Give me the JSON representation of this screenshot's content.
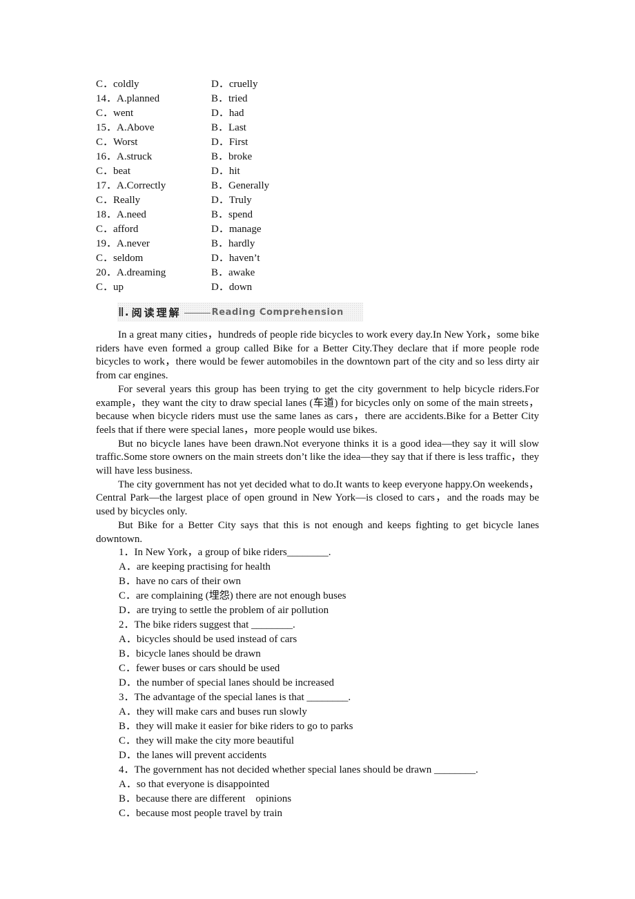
{
  "cloze_options": [
    {
      "left": "C．coldly",
      "right": "D．cruelly"
    },
    {
      "left": "14．A.planned",
      "right": "B．tried"
    },
    {
      "left": "C．went",
      "right": "D．had"
    },
    {
      "left": "15．A.Above",
      "right": "B．Last"
    },
    {
      "left": "C．Worst",
      "right": "D．First"
    },
    {
      "left": "16．A.struck",
      "right": "B．broke"
    },
    {
      "left": "C．beat",
      "right": "D．hit"
    },
    {
      "left": "17．A.Correctly",
      "right": "B．Generally"
    },
    {
      "left": "C．Really",
      "right": "D．Truly"
    },
    {
      "left": "18．A.need",
      "right": "B．spend"
    },
    {
      "left": "C．afford",
      "right": "D．manage"
    },
    {
      "left": "19．A.never",
      "right": "B．hardly"
    },
    {
      "left": "C．seldom",
      "right": "D．haven’t"
    },
    {
      "left": "20．A.dreaming",
      "right": "B．awake"
    },
    {
      "left": "C．up",
      "right": "D．down"
    }
  ],
  "section": {
    "roman": "Ⅱ",
    "dot": ".",
    "title_cn": "阅读理解",
    "title_en": "Reading Comprehension"
  },
  "passage": [
    "In a great many cities，hundreds of people ride bicycles to work every day.In New York，some bike riders have even formed a group called Bike for a Better City.They declare that if more people rode bicycles to work，there would be fewer automobiles in the downtown part of the city and so less dirty air from car engines.",
    "For several years this group has been trying to get the city government to help bicycle riders.For example，they want the city to draw special lanes (车道) for bicycles only on some of the main streets，because when bicycle riders must use the same lanes as cars，there are accidents.Bike for a Better City feels that if there were special lanes，more people would use bikes.",
    "But no bicycle lanes have been drawn.Not everyone thinks it is a good idea—they say it will slow traffic.Some store owners on the main streets don’t like the idea—they say that if there is less traffic，they will have less business.",
    "The city government has not yet decided what to do.It wants to keep everyone happy.On weekends，Central Park—the largest place of open ground in New York—is closed to cars，and the roads may be used by bicycles only.",
    "But Bike for a Better City says that this is not enough and keeps fighting to get bicycle lanes downtown."
  ],
  "questions": [
    {
      "stem": "1．In New York，a group of bike riders________.",
      "options": [
        "A．are keeping practising for health",
        "B．have no cars of their own",
        "C．are complaining (埋怨) there are not enough buses",
        "D．are trying to settle the problem of air pollution"
      ]
    },
    {
      "stem": "2．The bike riders suggest that ________.",
      "options": [
        "A．bicycles should be used instead of cars",
        "B．bicycle lanes should be drawn",
        "C．fewer buses or cars should be used",
        "D．the number of special lanes should be increased"
      ]
    },
    {
      "stem": "3．The advantage of the special lanes is that ________.",
      "options": [
        "A．they will make cars and buses run slowly",
        "B．they will make it easier for bike riders to go to parks",
        "C．they will make the city more beautiful",
        "D．the lanes will prevent accidents"
      ]
    },
    {
      "stem": "4．The government has not decided whether special lanes should be drawn ________.",
      "options": [
        "A．so that everyone is disappointed",
        "B．because there are different    opinions",
        "C．because most people travel by train"
      ]
    }
  ]
}
